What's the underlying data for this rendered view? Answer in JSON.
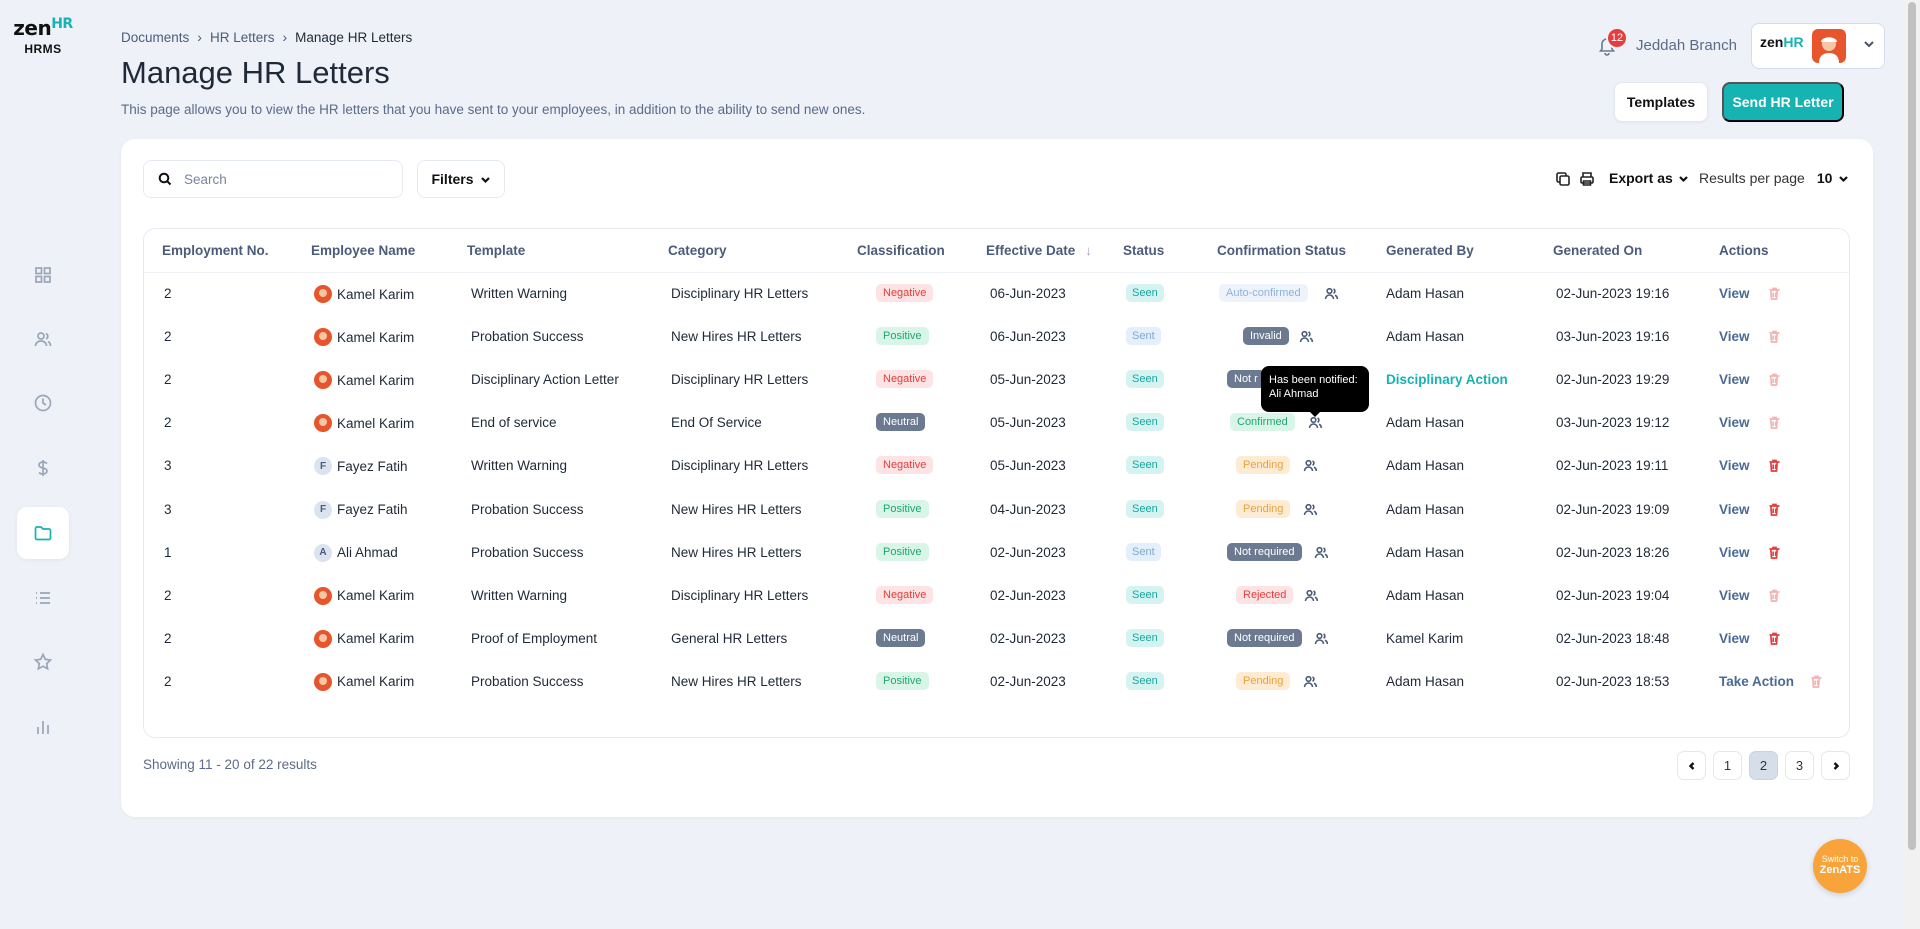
{
  "brand": {
    "logo_main": "zen",
    "logo_hr": "HR",
    "logo_sub": "HRMS"
  },
  "sidebar": {
    "items": [
      {
        "icon": "dashboard-icon"
      },
      {
        "icon": "people-icon"
      },
      {
        "icon": "clock-icon"
      },
      {
        "icon": "dollar-icon"
      },
      {
        "icon": "folder-icon",
        "active": true
      },
      {
        "icon": "list-icon"
      },
      {
        "icon": "star-icon"
      },
      {
        "icon": "bar-chart-icon"
      }
    ]
  },
  "breadcrumb": {
    "items": [
      "Documents",
      "HR Letters"
    ],
    "current": "Manage HR Letters"
  },
  "page": {
    "title": "Manage HR Letters",
    "description": "This page allows you to view the HR letters that you have sent to your employees, in addition to the ability to send new ones."
  },
  "header": {
    "notification_count": "12",
    "branch": "Jeddah Branch",
    "profile_logo_main": "zen",
    "profile_logo_hr": "HR"
  },
  "actions": {
    "templates": "Templates",
    "send": "Send HR Letter"
  },
  "toolbar": {
    "search_placeholder": "Search",
    "filters": "Filters",
    "export": "Export as",
    "results_per_page_label": "Results per page",
    "results_per_page_value": "10"
  },
  "table": {
    "columns": [
      "Employment No.",
      "Employee Name",
      "Template",
      "Category",
      "Classification",
      "Effective Date",
      "Status",
      "Confirmation Status",
      "Generated By",
      "Generated On",
      "Actions"
    ],
    "sort_indicator": "↓",
    "rows": [
      {
        "no": "2",
        "avatar": "img",
        "initial": "",
        "name": "Kamel Karim",
        "template": "Written Warning",
        "category": "Disciplinary HR Letters",
        "classification": "Negative",
        "cls": "negative",
        "date": "06-Jun-2023",
        "status": "Seen",
        "st": "seen",
        "conf": "Auto-confirmed",
        "cs": "cs-auto",
        "by": "Adam Hasan",
        "on": "02-Jun-2023 19:16",
        "action": "View",
        "trash": "disabled"
      },
      {
        "no": "2",
        "avatar": "img",
        "initial": "",
        "name": "Kamel Karim",
        "template": "Probation Success",
        "category": "New Hires HR Letters",
        "classification": "Positive",
        "cls": "positive",
        "date": "06-Jun-2023",
        "status": "Sent",
        "st": "sent",
        "conf": "Invalid",
        "cs": "cs-invalid",
        "by": "Adam Hasan",
        "on": "03-Jun-2023 19:16",
        "action": "View",
        "trash": "disabled"
      },
      {
        "no": "2",
        "avatar": "img",
        "initial": "",
        "name": "Kamel Karim",
        "template": "Disciplinary Action Letter",
        "category": "Disciplinary HR Letters",
        "classification": "Negative",
        "cls": "negative",
        "date": "05-Jun-2023",
        "status": "Seen",
        "st": "seen",
        "conf": "Not r",
        "cs": "cs-notreq",
        "by": "Disciplinary Action",
        "on": "02-Jun-2023 19:29",
        "action": "View",
        "trash": "disabled"
      },
      {
        "no": "2",
        "avatar": "img",
        "initial": "",
        "name": "Kamel Karim",
        "template": "End of service",
        "category": "End Of Service",
        "classification": "Neutral",
        "cls": "neutral",
        "date": "05-Jun-2023",
        "status": "Seen",
        "st": "seen",
        "conf": "Confirmed",
        "cs": "cs-confirmed",
        "by": "Adam Hasan",
        "on": "03-Jun-2023 19:12",
        "action": "View",
        "trash": "disabled"
      },
      {
        "no": "3",
        "avatar": "letter",
        "initial": "F",
        "name": "Fayez Fatih",
        "template": "Written Warning",
        "category": "Disciplinary HR Letters",
        "classification": "Negative",
        "cls": "negative",
        "date": "05-Jun-2023",
        "status": "Seen",
        "st": "seen",
        "conf": "Pending",
        "cs": "cs-pending",
        "by": "Adam Hasan",
        "on": "02-Jun-2023 19:11",
        "action": "View",
        "trash": "enabled"
      },
      {
        "no": "3",
        "avatar": "letter",
        "initial": "F",
        "name": "Fayez Fatih",
        "template": "Probation Success",
        "category": "New Hires HR Letters",
        "classification": "Positive",
        "cls": "positive",
        "date": "04-Jun-2023",
        "status": "Seen",
        "st": "seen",
        "conf": "Pending",
        "cs": "cs-pending",
        "by": "Adam Hasan",
        "on": "02-Jun-2023 19:09",
        "action": "View",
        "trash": "enabled"
      },
      {
        "no": "1",
        "avatar": "letter",
        "initial": "A",
        "name": "Ali Ahmad",
        "template": "Probation Success",
        "category": "New Hires HR Letters",
        "classification": "Positive",
        "cls": "positive",
        "date": "02-Jun-2023",
        "status": "Sent",
        "st": "sent",
        "conf": "Not required",
        "cs": "cs-notreq",
        "by": "Adam Hasan",
        "on": "02-Jun-2023 18:26",
        "action": "View",
        "trash": "enabled"
      },
      {
        "no": "2",
        "avatar": "img",
        "initial": "",
        "name": "Kamel Karim",
        "template": "Written Warning",
        "category": "Disciplinary HR Letters",
        "classification": "Negative",
        "cls": "negative",
        "date": "02-Jun-2023",
        "status": "Seen",
        "st": "seen",
        "conf": "Rejected",
        "cs": "cs-rejected",
        "by": "Adam Hasan",
        "on": "02-Jun-2023 19:04",
        "action": "View",
        "trash": "disabled"
      },
      {
        "no": "2",
        "avatar": "img",
        "initial": "",
        "name": "Kamel Karim",
        "template": "Proof of Employment",
        "category": "General HR Letters",
        "classification": "Neutral",
        "cls": "neutral",
        "date": "02-Jun-2023",
        "status": "Seen",
        "st": "seen",
        "conf": "Not required",
        "cs": "cs-notreq",
        "by": "Kamel Karim",
        "on": "02-Jun-2023 18:48",
        "action": "View",
        "trash": "enabled"
      },
      {
        "no": "2",
        "avatar": "img",
        "initial": "",
        "name": "Kamel Karim",
        "template": "Probation Success",
        "category": "New Hires HR Letters",
        "classification": "Positive",
        "cls": "positive",
        "date": "02-Jun-2023",
        "status": "Seen",
        "st": "seen",
        "conf": "Pending",
        "cs": "cs-pending",
        "by": "Adam Hasan",
        "on": "02-Jun-2023 18:53",
        "action": "Take Action",
        "trash": "disabled"
      }
    ]
  },
  "tooltip": {
    "line1": "Has been notified:",
    "line2": "Ali Ahmad"
  },
  "footer": {
    "showing": "Showing 11 - 20 of 22 results",
    "pages": [
      "1",
      "2",
      "3"
    ],
    "current_page": "2"
  },
  "switch": {
    "line1": "Switch to",
    "line2": "ZenATS"
  },
  "colors": {
    "accent": "#16b3b3",
    "danger": "#e53e3e",
    "switch": "#f8a43a"
  }
}
